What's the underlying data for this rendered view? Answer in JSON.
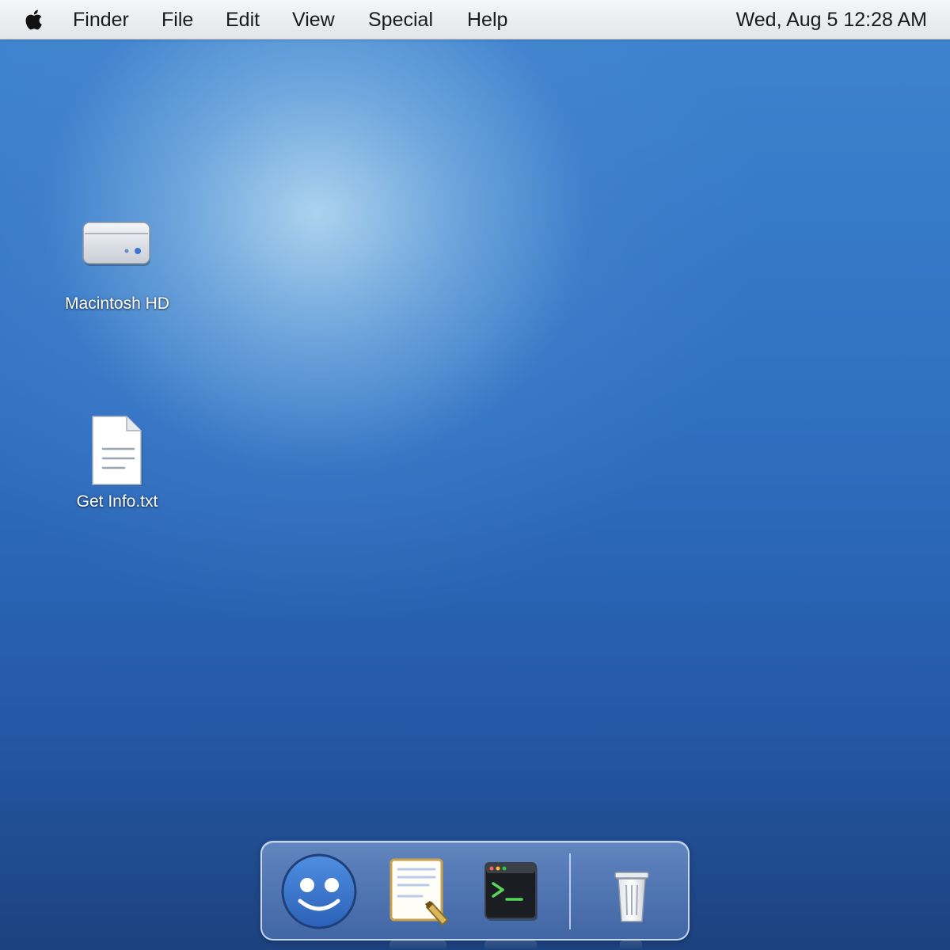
{
  "menubar": {
    "apple_icon": "apple-logo-icon",
    "items": [
      {
        "label": "Finder"
      },
      {
        "label": "File"
      },
      {
        "label": "Edit"
      },
      {
        "label": "View"
      },
      {
        "label": "Special"
      },
      {
        "label": "Help"
      }
    ],
    "clock": "Wed, Aug 5 12:28 AM"
  },
  "desktop": {
    "icons": [
      {
        "label": "Macintosh HD",
        "icon": "hard-drive-icon"
      },
      {
        "label": "Get Info.txt",
        "icon": "text-document-icon"
      }
    ]
  },
  "dock": {
    "items": [
      {
        "icon": "finder-icon"
      },
      {
        "icon": "textedit-icon"
      },
      {
        "icon": "terminal-icon"
      },
      {
        "icon": "trash-icon"
      }
    ]
  },
  "colors": {
    "desktop_blue": "#2f6fc0",
    "terminal_green": "#5bd45b"
  }
}
